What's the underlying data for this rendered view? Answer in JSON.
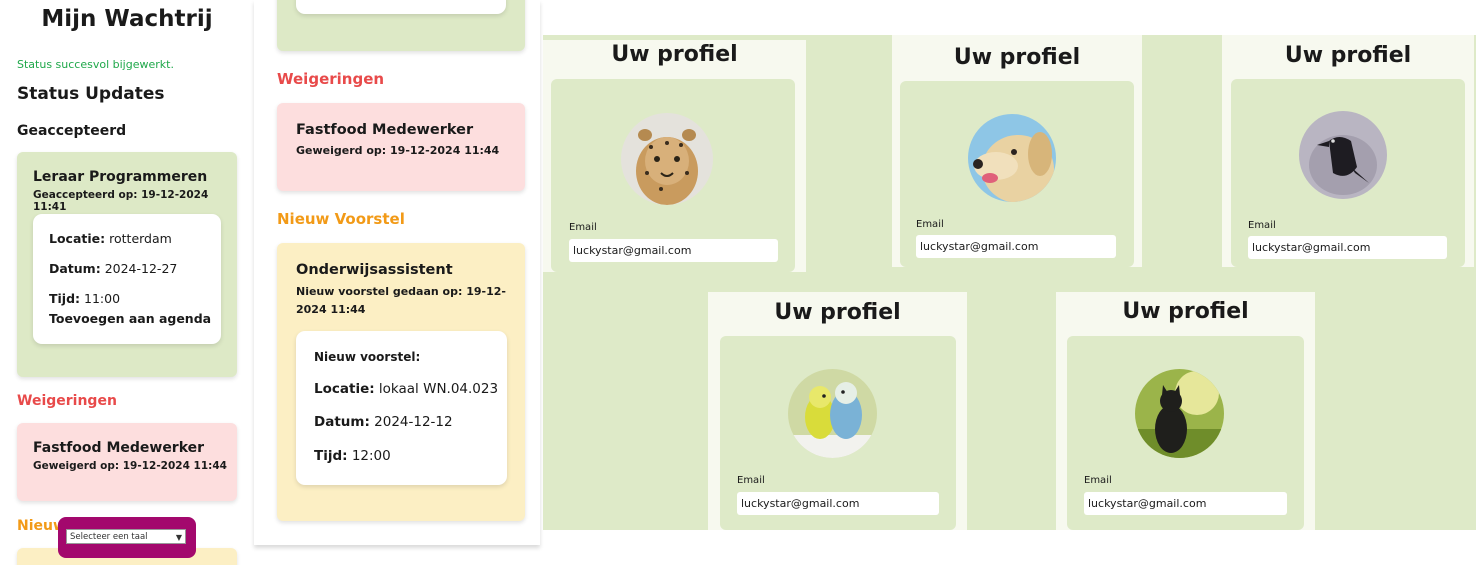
{
  "panel1": {
    "title": "Mijn Wachtrij",
    "flash": "Status succesvol bijgewerkt.",
    "status_heading": "Status Updates",
    "accepted_heading": "Geaccepteerd",
    "accepted_card": {
      "title": "Leraar Programmeren",
      "subtitle": "Geaccepteerd op: 19-12-2024 11:41",
      "location_label": "Locatie:",
      "location_value": "rotterdam",
      "date_label": "Datum:",
      "date_value": "2024-12-27",
      "time_label": "Tijd:",
      "time_value": "11:00",
      "agenda_link": "Toevoegen aan agenda"
    },
    "rejections_heading": "Weigeringen",
    "rejection_card": {
      "title": "Fastfood Medewerker",
      "subtitle": "Geweigerd op: 19-12-2024 11:44"
    },
    "new_proposal_heading": "Nieuw",
    "language_select": "Selecteer een taal"
  },
  "panel2": {
    "rejections_heading": "Weigeringen",
    "rejection_card": {
      "title": "Fastfood Medewerker",
      "subtitle": "Geweigerd op: 19-12-2024 11:44"
    },
    "new_proposal_heading": "Nieuw Voorstel",
    "proposal_card": {
      "title": "Onderwijsassistent",
      "subtitle": "Nieuw voorstel gedaan op: 19-12-2024 11:44",
      "inner_heading": "Nieuw voorstel:",
      "location_label": "Locatie:",
      "location_value": "lokaal WN.04.023",
      "date_label": "Datum:",
      "date_value": "2024-12-12",
      "time_label": "Tijd:",
      "time_value": "12:00"
    }
  },
  "profiles": [
    {
      "heading": "Uw profiel",
      "avatar": "cheetah-cub",
      "email_label": "Email",
      "email": "luckystar@gmail.com"
    },
    {
      "heading": "Uw profiel",
      "avatar": "golden-retriever",
      "email_label": "Email",
      "email": "luckystar@gmail.com"
    },
    {
      "heading": "Uw profiel",
      "avatar": "crow",
      "email_label": "Email",
      "email": "luckystar@gmail.com"
    },
    {
      "heading": "Uw profiel",
      "avatar": "budgies",
      "email_label": "Email",
      "email": "luckystar@gmail.com"
    },
    {
      "heading": "Uw profiel",
      "avatar": "black-cat",
      "email_label": "Email",
      "email": "luckystar@gmail.com"
    }
  ],
  "colors": {
    "accepted_bg": "#dde9c6",
    "rejected_bg": "#fddede",
    "proposal_bg": "#fcefc4",
    "success_text": "#1fa84a",
    "rejection_heading": "#e84a4a",
    "proposal_heading": "#f29a17",
    "language_widget": "#a3086d"
  }
}
